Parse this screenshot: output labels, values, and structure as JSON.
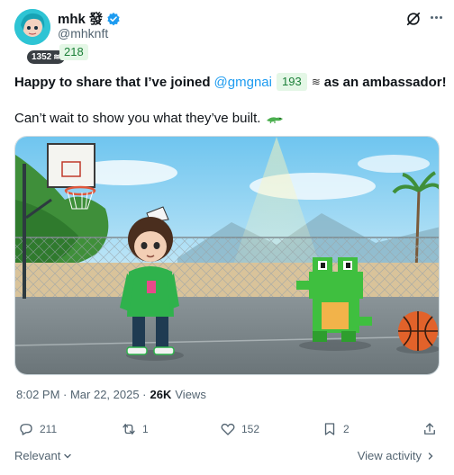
{
  "author": {
    "display_name": "mhk 發",
    "handle": "@mhknft",
    "handle_score": "218",
    "rank_badge": "1352",
    "avatar_icon": "avatar-image",
    "verified_color": "#1d9bf0"
  },
  "tweet": {
    "line1_prefix": "Happy to share that I’ve joined",
    "mention": "@gmgnai",
    "mention_score": "193",
    "line1_suffix": "as an ambassador!",
    "line2": "Can’t wait to show you what they’ve built.",
    "media_alt": "pixel-art basketball court with a boy and a green frog"
  },
  "meta": {
    "time": "8:02 PM · Mar 22, 2025 ·",
    "views_count": "26K",
    "views_label": "Views"
  },
  "actions": {
    "replies": "211",
    "reposts": "1",
    "likes": "152",
    "bookmarks": "2"
  },
  "footer": {
    "sort_label": "Relevant",
    "view_activity": "View activity"
  },
  "colors": {
    "accent": "#1d9bf0",
    "text": "#0f1419",
    "muted": "#536471",
    "score_bg": "#e4f7e6",
    "score_text": "#1a7f37"
  }
}
